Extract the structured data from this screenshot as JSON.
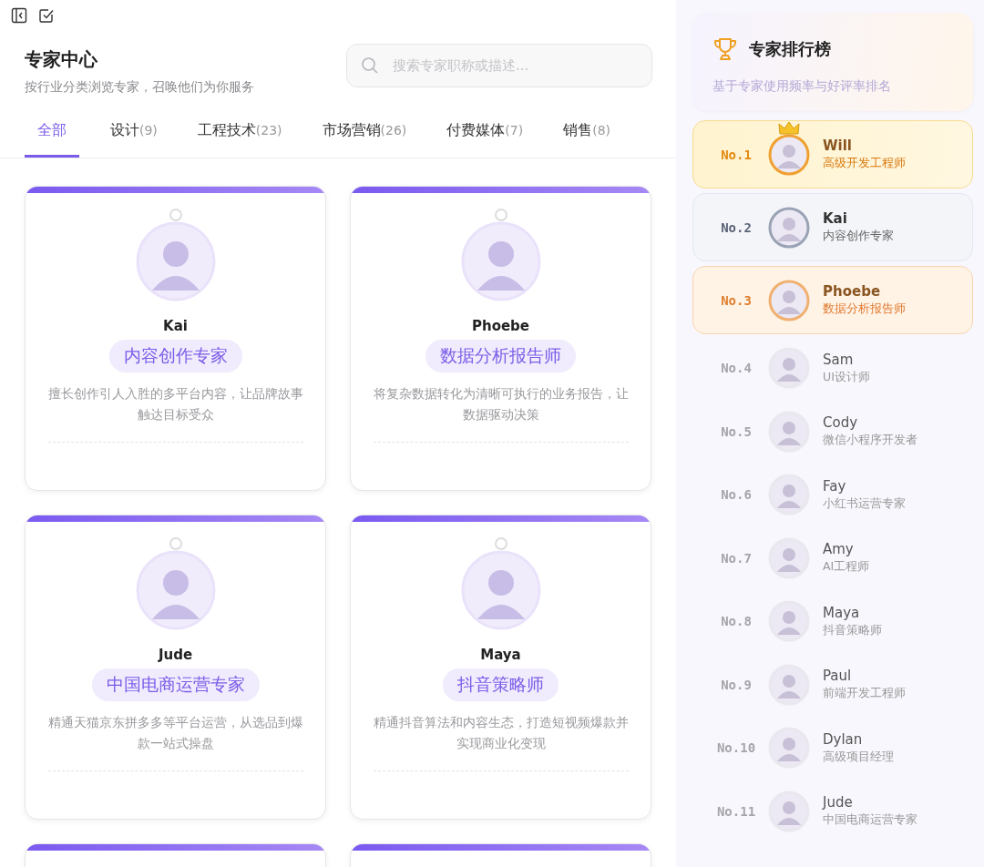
{
  "header": {
    "title": "专家中心",
    "subtitle": "按行业分类浏览专家，召唤他们为你服务"
  },
  "search": {
    "placeholder": "搜索专家职称或描述..."
  },
  "tabs": [
    {
      "label": "全部",
      "selected": true
    },
    {
      "label": "设计",
      "count": "(9)",
      "selected": false
    },
    {
      "label": "工程技术",
      "count": "(23)",
      "selected": false
    },
    {
      "label": "市场营销",
      "count": "(26)",
      "selected": false
    },
    {
      "label": "付费媒体",
      "count": "(7)",
      "selected": false
    },
    {
      "label": "销售",
      "count": "(8)",
      "selected": false
    }
  ],
  "cards": [
    {
      "name": "Kai",
      "role": "内容创作专家",
      "description": "擅长创作引人入胜的多平台内容，让品牌故事触达目标受众"
    },
    {
      "name": "Phoebe",
      "role": "数据分析报告师",
      "description": "将复杂数据转化为清晰可执行的业务报告，让数据驱动决策"
    },
    {
      "name": "Jude",
      "role": "中国电商运营专家",
      "description": "精通天猫京东拼多多等平台运营，从选品到爆款一站式操盘"
    },
    {
      "name": "Maya",
      "role": "抖音策略师",
      "description": "精通抖音算法和内容生态，打造短视频爆款并实现商业化变现"
    }
  ],
  "leaderboard": {
    "title": "专家排行榜",
    "subtitle": "基于专家使用频率与好评率排名",
    "items": [
      {
        "rank": "No.1",
        "name": "Will",
        "role": "高级开发工程师",
        "kind": "gold"
      },
      {
        "rank": "No.2",
        "name": "Kai",
        "role": "内容创作专家",
        "kind": "silver"
      },
      {
        "rank": "No.3",
        "name": "Phoebe",
        "role": "数据分析报告师",
        "kind": "bronze"
      },
      {
        "rank": "No.4",
        "name": "Sam",
        "role": "UI设计师",
        "kind": "plain"
      },
      {
        "rank": "No.5",
        "name": "Cody",
        "role": "微信小程序开发者",
        "kind": "plain"
      },
      {
        "rank": "No.6",
        "name": "Fay",
        "role": "小红书运营专家",
        "kind": "plain"
      },
      {
        "rank": "No.7",
        "name": "Amy",
        "role": "AI工程师",
        "kind": "plain"
      },
      {
        "rank": "No.8",
        "name": "Maya",
        "role": "抖音策略师",
        "kind": "plain"
      },
      {
        "rank": "No.9",
        "name": "Paul",
        "role": "前端开发工程师",
        "kind": "plain"
      },
      {
        "rank": "No.10",
        "name": "Dylan",
        "role": "高级项目经理",
        "kind": "plain"
      },
      {
        "rank": "No.11",
        "name": "Jude",
        "role": "中国电商运营专家",
        "kind": "plain"
      }
    ]
  }
}
